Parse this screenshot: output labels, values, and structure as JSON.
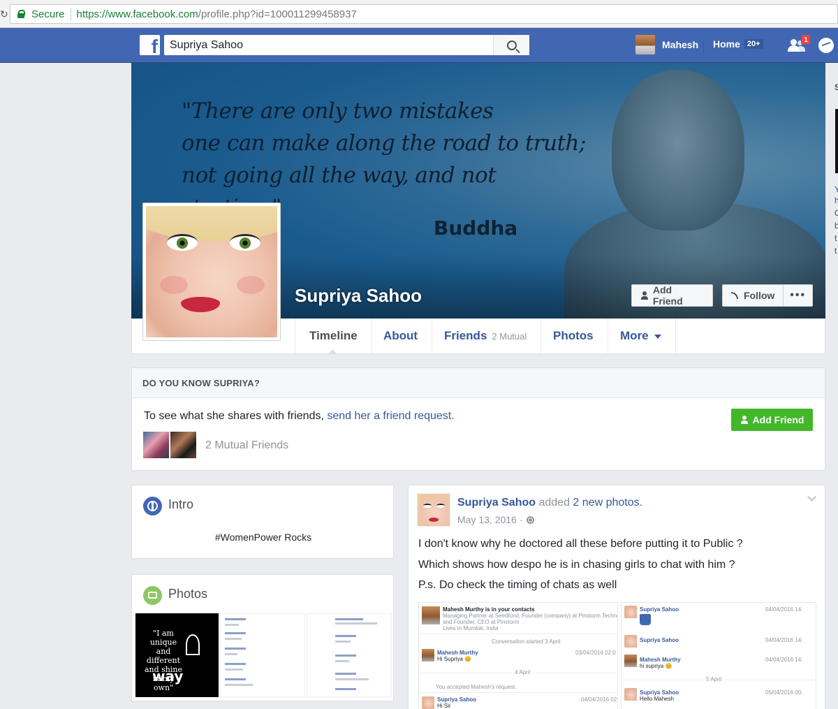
{
  "browser": {
    "secure_label": "Secure",
    "url_host": "https://www.facebook.com",
    "url_path": "/profile.php?id=100011299458937"
  },
  "header": {
    "logo": "f",
    "search_value": "Supriya Sahoo",
    "user_name": "Mahesh",
    "home_label": "Home",
    "home_count": "20+",
    "friend_requests_badge": "1",
    "brand_color": "#4267b2"
  },
  "cover": {
    "quote_line1": "\"There are only two mistakes",
    "quote_line2": "one can make along the road to truth;",
    "quote_line3": "not going all the way, and not starting.\"",
    "quote_author": "Buddha"
  },
  "profile": {
    "name": "Supriya Sahoo",
    "add_friend_label": "Add Friend",
    "follow_label": "Follow",
    "more_label": "•••"
  },
  "tabs": [
    {
      "label": "Timeline"
    },
    {
      "label": "About"
    },
    {
      "label": "Friends",
      "sub": "2 Mutual"
    },
    {
      "label": "Photos"
    },
    {
      "label": "More"
    }
  ],
  "know_card": {
    "title": "DO YOU KNOW SUPRIYA?",
    "text": "To see what she shares with friends, ",
    "link": "send her a friend request.",
    "add_friend_label": "Add Friend",
    "mutual_friends": "2 Mutual Friends",
    "button_color": "#42b72a"
  },
  "intro": {
    "title": "Intro",
    "bio": "#WomenPower Rocks"
  },
  "photos": {
    "title": "Photos",
    "photo1_text": [
      "\"I am",
      "unique",
      "and different",
      "and shine",
      "in my own\""
    ],
    "photo1_big": "way"
  },
  "post": {
    "author": "Supriya Sahoo",
    "action": " added ",
    "action_link": "2 new photos.",
    "date": "May 13, 2016 ·",
    "lines": [
      "I don't know why he doctored all these before putting it to Public ?",
      "Which shows how despo he is in chasing girls to chat with him ?",
      "P.s. Do check the timing of chats as well"
    ],
    "image1": {
      "contact_title": "Mahesh Murthy is in your contacts",
      "contact_l1": "Managing Partner at Seedfund, Founder (company) at Pinstorm Technologies Pvt Ltd",
      "contact_l2": "and Founder, CEO at Pinstorm",
      "contact_l3": "Lives in Mumbai, India",
      "conv_started": "Conversation started 3 April",
      "m_name": "Mahesh Murthy",
      "m_msg": "Hi Supriya 😊",
      "m_time": "03/04/2016 02:0",
      "date_sep": "4 April",
      "accepted": "You accepted Mahesh's request.",
      "s_name": "Supriya Sahoo",
      "s_msg": "Hi Sir",
      "s_time": "04/04/2016 02:0"
    },
    "image2": {
      "s1_name": "Supriya Sahoo",
      "s1_time": "04/04/2016 14:",
      "s2_name": "Supriya Sahoo",
      "s2_time": "04/04/2016 14:",
      "m_name": "Mahesh Murthy",
      "m_msg": "hi supriya 😊",
      "m_time": "04/04/2016 14:",
      "date_sep": "5 April",
      "s3_name": "Supriya Sahoo",
      "s3_msg": "Hello Mahesh",
      "s3_time": "05/04/2016 00:"
    }
  },
  "right_strip": {
    "t1": "S",
    "t2": "Y",
    "t3": "h",
    "t4": "C",
    "t5": "b",
    "t6": "t",
    "t7": "t"
  }
}
